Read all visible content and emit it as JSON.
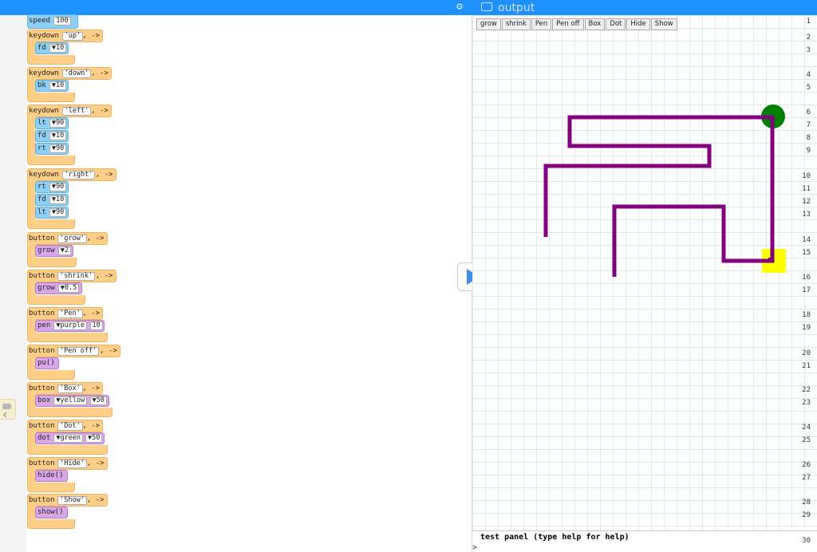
{
  "header": {
    "output_title": "output"
  },
  "editor": {
    "line_numbers": [
      "1",
      "2",
      "3",
      "4",
      "5",
      "6",
      "7",
      "8",
      "9",
      "10",
      "11",
      "12",
      "13",
      "14",
      "15",
      "16",
      "17",
      "18",
      "19",
      "20",
      "21",
      "22",
      "23",
      "24",
      "25",
      "26",
      "27",
      "28",
      "29",
      "30"
    ],
    "speed": {
      "keyword": "speed",
      "value": "100"
    },
    "events": [
      {
        "keyword": "keydown",
        "arg": "'up'",
        "arrow": ", ->",
        "cmds": [
          {
            "op": "fd",
            "args": [
              "▼10"
            ],
            "color": "blue"
          }
        ]
      },
      {
        "keyword": "keydown",
        "arg": "'down'",
        "arrow": ", ->",
        "cmds": [
          {
            "op": "bk",
            "args": [
              "▼10"
            ],
            "color": "blue"
          }
        ]
      },
      {
        "keyword": "keydown",
        "arg": "'left'",
        "arrow": ", ->",
        "cmds": [
          {
            "op": "lt",
            "args": [
              "▼90"
            ],
            "color": "blue"
          },
          {
            "op": "fd",
            "args": [
              "▼10"
            ],
            "color": "blue"
          },
          {
            "op": "rt",
            "args": [
              "▼90"
            ],
            "color": "blue"
          }
        ]
      },
      {
        "keyword": "keydown",
        "arg": "'right'",
        "arrow": ", ->",
        "cmds": [
          {
            "op": "rt",
            "args": [
              "▼90"
            ],
            "color": "blue"
          },
          {
            "op": "fd",
            "args": [
              "▼10"
            ],
            "color": "blue"
          },
          {
            "op": "lt",
            "args": [
              "▼90"
            ],
            "color": "blue"
          }
        ]
      },
      {
        "keyword": "button",
        "arg": "'grow'",
        "arrow": ", ->",
        "cmds": [
          {
            "op": "grow",
            "args": [
              "▼2"
            ],
            "color": "purple"
          }
        ]
      },
      {
        "keyword": "button",
        "arg": "'shrink'",
        "arrow": ", ->",
        "cmds": [
          {
            "op": "grow",
            "args": [
              "▼0.5"
            ],
            "color": "purple"
          }
        ]
      },
      {
        "keyword": "button",
        "arg": "'Pen'",
        "arrow": ", ->",
        "cmds": [
          {
            "op": "pen",
            "args": [
              "▼purple",
              "10"
            ],
            "color": "purple"
          }
        ]
      },
      {
        "keyword": "button",
        "arg": "'Pen off'",
        "arrow": ", ->",
        "cmds": [
          {
            "op": "pu()",
            "args": [],
            "color": "purple"
          }
        ]
      },
      {
        "keyword": "button",
        "arg": "'Box'",
        "arrow": ", ->",
        "cmds": [
          {
            "op": "box",
            "args": [
              "▼yellow",
              "▼50"
            ],
            "color": "purple"
          }
        ]
      },
      {
        "keyword": "button",
        "arg": "'Dot'",
        "arrow": ", ->",
        "cmds": [
          {
            "op": "dot",
            "args": [
              "▼green",
              "▼50"
            ],
            "color": "purple"
          }
        ]
      },
      {
        "keyword": "button",
        "arg": "'Hide'",
        "arrow": ", ->",
        "cmds": [
          {
            "op": "hide()",
            "args": [],
            "color": "purple"
          }
        ]
      },
      {
        "keyword": "button",
        "arg": "'Show'",
        "arrow": ", ->",
        "cmds": [
          {
            "op": "show()",
            "args": [],
            "color": "purple"
          }
        ]
      }
    ]
  },
  "output": {
    "buttons": [
      "grow",
      "shrink",
      "Pen",
      "Pen off",
      "Box",
      "Dot",
      "Hide",
      "Show"
    ],
    "drawing": {
      "pen_color": "#800080",
      "box_color": "#ffff00",
      "dot_color": "#008000"
    }
  },
  "test_panel": {
    "title": "test panel (type help for help)",
    "prompt": ">"
  },
  "icons": {
    "settings": "gear-icon",
    "output": "output-window-icon",
    "run": "play-icon",
    "side_toggle": "chat-icon"
  }
}
